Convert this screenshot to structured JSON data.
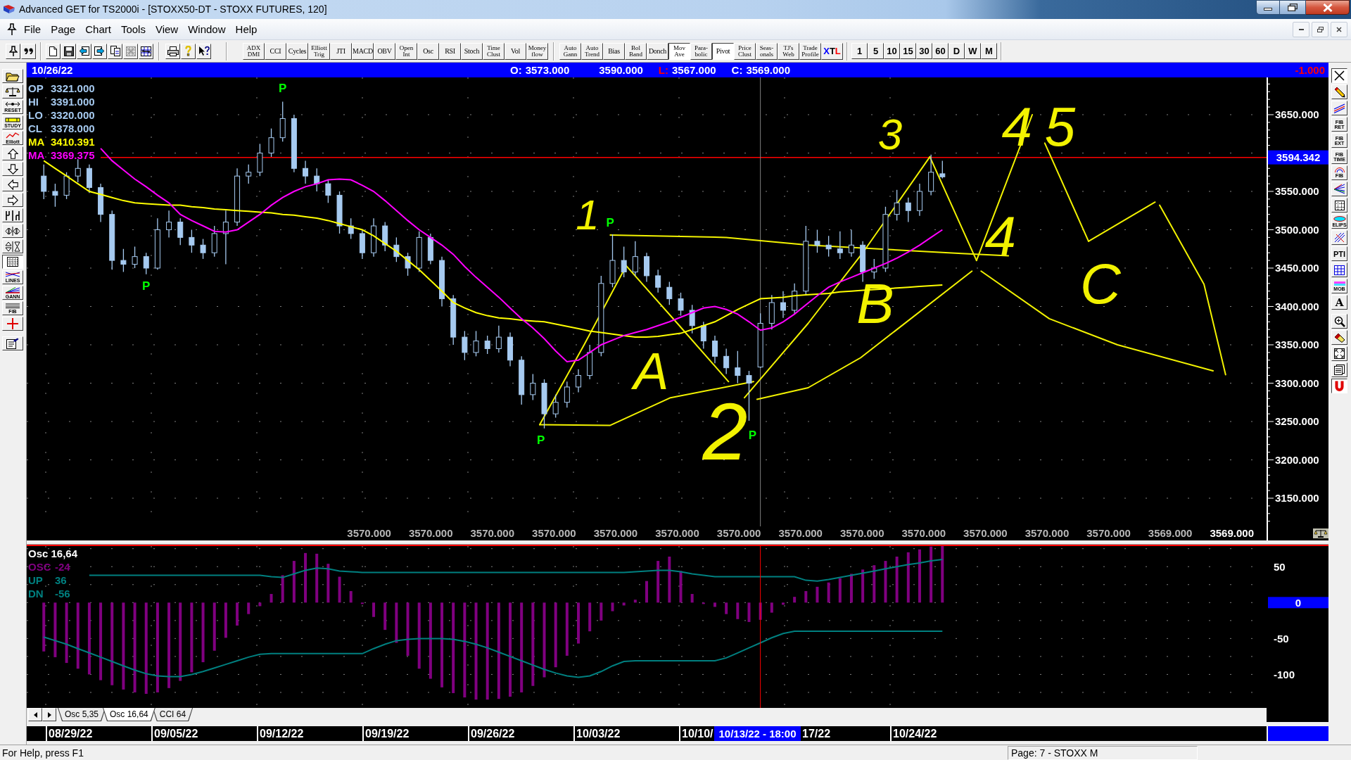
{
  "window": {
    "title": "Advanced GET for TS2000i - [STOXX50-DT - STOXX FUTURES, 120]"
  },
  "menu": [
    "File",
    "Page",
    "Chart",
    "Tools",
    "View",
    "Window",
    "Help"
  ],
  "toolbar": {
    "indicators": [
      {
        "label": "ADX\nDMI",
        "pressed": false
      },
      {
        "label": "CCI",
        "pressed": false
      },
      {
        "label": "Cycles",
        "pressed": false
      },
      {
        "label": "Elliott\nTrig",
        "pressed": false
      },
      {
        "label": "JTI",
        "pressed": false
      },
      {
        "label": "MACD",
        "pressed": false
      },
      {
        "label": "OBV",
        "pressed": false
      },
      {
        "label": "Open\nInt",
        "pressed": false
      },
      {
        "label": "Osc",
        "pressed": false
      },
      {
        "label": "RSI",
        "pressed": false
      },
      {
        "label": "Stoch",
        "pressed": false
      },
      {
        "label": "Time\nClust",
        "pressed": false
      },
      {
        "label": "Vol",
        "pressed": false
      },
      {
        "label": "Money\nflow",
        "pressed": false
      }
    ],
    "studies": [
      {
        "label": "Auto\nGann",
        "pressed": false
      },
      {
        "label": "Auto\nTrend",
        "pressed": false
      },
      {
        "label": "Bias",
        "pressed": false
      },
      {
        "label": "Bol\nBand",
        "pressed": false
      },
      {
        "label": "Donch",
        "pressed": false
      },
      {
        "label": "Mov\nAve",
        "pressed": true
      },
      {
        "label": "Para-\nbolic",
        "pressed": false
      },
      {
        "label": "Pivot",
        "pressed": true
      },
      {
        "label": "Price\nClust",
        "pressed": false
      },
      {
        "label": "Seas-\nonals",
        "pressed": false
      },
      {
        "label": "TJ's\nWeb",
        "pressed": false
      },
      {
        "label": "Trade\nProfile",
        "pressed": false
      },
      {
        "parts": [
          {
            "text": "X",
            "color": "#0000ff"
          },
          {
            "text": "T",
            "color": "#000000"
          },
          {
            "text": "L",
            "color": "#ff0000"
          }
        ],
        "pressed": false
      }
    ],
    "intervals": [
      {
        "label": "1",
        "pressed": false
      },
      {
        "label": "5",
        "pressed": false
      },
      {
        "label": "10",
        "pressed": false
      },
      {
        "label": "15",
        "pressed": false
      },
      {
        "label": "30",
        "pressed": false
      },
      {
        "label": "60",
        "pressed": false
      },
      {
        "label": "D",
        "pressed": false
      },
      {
        "label": "W",
        "pressed": false
      },
      {
        "label": "M",
        "pressed": false
      }
    ]
  },
  "left_toolbar": [
    {
      "kind": "open",
      "pressed": false
    },
    {
      "kind": "scales",
      "pressed": false
    },
    {
      "kind": "reset",
      "label": "RESET",
      "pressed": false
    },
    {
      "kind": "study",
      "label": "STUDY",
      "pressed": false
    },
    {
      "kind": "elliott",
      "label": "Elliott",
      "pressed": false
    },
    {
      "kind": "up",
      "pressed": false
    },
    {
      "kind": "down",
      "pressed": false
    },
    {
      "kind": "left",
      "pressed": false
    },
    {
      "kind": "right",
      "pressed": false
    },
    {
      "kind": "split",
      "pressed": false
    },
    {
      "kind": "h_arrows",
      "pressed": false
    },
    {
      "kind": "v_arrows",
      "pressed": false
    },
    {
      "kind": "grid",
      "pressed": true
    },
    {
      "kind": "lines",
      "label": "LINES",
      "pressed": false
    },
    {
      "kind": "gann",
      "label": "GANN",
      "pressed": false
    },
    {
      "kind": "fib",
      "label": "FIB",
      "pressed": false
    },
    {
      "kind": "cross",
      "pressed": false
    },
    {
      "kind": "clipboard",
      "pressed": false
    }
  ],
  "info_bar": {
    "date": "10/26/22",
    "quotes": [
      {
        "label": "O:",
        "color": "#ffffff",
        "value": "3573.000"
      },
      {
        "value": "3590.000"
      },
      {
        "label": "L:",
        "color": "#ff0000",
        "value": "3567.000"
      },
      {
        "label": "C:",
        "color": "#ffffff",
        "value": "3569.000"
      }
    ],
    "change": "-1.000"
  },
  "price_chart": {
    "legend": [
      {
        "label": "OP",
        "value": "3321.000",
        "color": "#a6caf0"
      },
      {
        "label": "HI",
        "value": "3391.000",
        "color": "#a6caf0"
      },
      {
        "label": "LO",
        "value": "3320.000",
        "color": "#a6caf0"
      },
      {
        "label": "CL",
        "value": "3378.000",
        "color": "#a6caf0"
      },
      {
        "label": "MA",
        "value": "3410.391",
        "color": "#ffff00"
      },
      {
        "label": "MA",
        "value": "3369.375",
        "color": "#ff00ff"
      }
    ],
    "chart_data": {
      "type": "candlestick",
      "ylim": [
        3113.3,
        3698.6
      ],
      "grid": true,
      "yticks": [
        {
          "value": 3150,
          "label": "3150.000"
        },
        {
          "value": 3200,
          "label": "3200.000"
        },
        {
          "value": 3250,
          "label": "3250.000"
        },
        {
          "value": 3300,
          "label": "3300.000"
        },
        {
          "value": 3350,
          "label": "3350.000"
        },
        {
          "value": 3400,
          "label": "3400.000"
        },
        {
          "value": 3450,
          "label": "3450.000"
        },
        {
          "value": 3500,
          "label": "3500.000"
        },
        {
          "value": 3550,
          "label": "3550.000"
        },
        {
          "value": 3650,
          "label": "3650.000"
        }
      ],
      "ohlc": [
        null,
        [
          3570,
          3585,
          3540,
          3550
        ],
        [
          3550,
          3560,
          3530,
          3545
        ],
        [
          3545,
          3575,
          3540,
          3570
        ],
        [
          3570,
          3592,
          3562,
          3580
        ],
        [
          3580,
          3585,
          3548,
          3555
        ],
        [
          3555,
          3560,
          3510,
          3520
        ],
        [
          3520,
          3525,
          3448,
          3460
        ],
        [
          3460,
          3475,
          3445,
          3455
        ],
        [
          3455,
          3478,
          3450,
          3465
        ],
        [
          3465,
          3470,
          3442,
          3450
        ],
        [
          3450,
          3515,
          3448,
          3500
        ],
        [
          3500,
          3525,
          3490,
          3510
        ],
        [
          3510,
          3515,
          3480,
          3490
        ],
        [
          3490,
          3500,
          3470,
          3480
        ],
        [
          3480,
          3488,
          3462,
          3470
        ],
        [
          3470,
          3505,
          3465,
          3495
        ],
        [
          3495,
          3525,
          3455,
          3510
        ],
        [
          3510,
          3580,
          3505,
          3570
        ],
        [
          3570,
          3585,
          3560,
          3575
        ],
        [
          3575,
          3612,
          3570,
          3600
        ],
        [
          3600,
          3632,
          3595,
          3620
        ],
        [
          3620,
          3667,
          3615,
          3645
        ],
        [
          3645,
          3650,
          3575,
          3580
        ],
        [
          3580,
          3590,
          3560,
          3570
        ],
        [
          3570,
          3580,
          3550,
          3560
        ],
        [
          3560,
          3565,
          3535,
          3545
        ],
        [
          3545,
          3550,
          3495,
          3505
        ],
        [
          3505,
          3515,
          3488,
          3495
        ],
        [
          3495,
          3500,
          3462,
          3470
        ],
        [
          3470,
          3515,
          3465,
          3505
        ],
        [
          3505,
          3510,
          3472,
          3480
        ],
        [
          3480,
          3490,
          3458,
          3465
        ],
        [
          3465,
          3470,
          3440,
          3450
        ],
        [
          3450,
          3498,
          3445,
          3490
        ],
        [
          3490,
          3495,
          3455,
          3460
        ],
        [
          3460,
          3465,
          3400,
          3410
        ],
        [
          3410,
          3415,
          3350,
          3360
        ],
        [
          3360,
          3368,
          3330,
          3340
        ],
        [
          3340,
          3368,
          3335,
          3355
        ],
        [
          3355,
          3362,
          3338,
          3345
        ],
        [
          3345,
          3375,
          3340,
          3360
        ],
        [
          3360,
          3366,
          3322,
          3330
        ],
        [
          3330,
          3335,
          3272,
          3285
        ],
        [
          3285,
          3312,
          3278,
          3300
        ],
        [
          3300,
          3305,
          3241,
          3260
        ],
        [
          3260,
          3285,
          3255,
          3275
        ],
        [
          3275,
          3302,
          3268,
          3295
        ],
        [
          3295,
          3318,
          3288,
          3310
        ],
        [
          3310,
          3350,
          3305,
          3340
        ],
        [
          3340,
          3440,
          3335,
          3430
        ],
        [
          3430,
          3494,
          3425,
          3460
        ],
        [
          3460,
          3478,
          3438,
          3445
        ],
        [
          3445,
          3485,
          3440,
          3465
        ],
        [
          3465,
          3470,
          3432,
          3440
        ],
        [
          3440,
          3448,
          3418,
          3425
        ],
        [
          3425,
          3432,
          3402,
          3410
        ],
        [
          3410,
          3418,
          3388,
          3395
        ],
        [
          3395,
          3402,
          3365,
          3375
        ],
        [
          3375,
          3380,
          3345,
          3355
        ],
        [
          3355,
          3362,
          3326,
          3335
        ],
        [
          3335,
          3345,
          3312,
          3320
        ],
        [
          3320,
          3342,
          3300,
          3310
        ],
        [
          3310,
          3316,
          3251,
          3300
        ],
        [
          3321,
          3391,
          3320,
          3378
        ],
        [
          3378,
          3415,
          3370,
          3405
        ],
        [
          3405,
          3420,
          3385,
          3395
        ],
        [
          3395,
          3430,
          3390,
          3420
        ],
        [
          3420,
          3505,
          3415,
          3485
        ],
        [
          3485,
          3500,
          3470,
          3480
        ],
        [
          3480,
          3492,
          3465,
          3475
        ],
        [
          3475,
          3498,
          3462,
          3470
        ],
        [
          3470,
          3500,
          3465,
          3480
        ],
        [
          3480,
          3485,
          3432,
          3445
        ],
        [
          3445,
          3462,
          3436,
          3450
        ],
        [
          3450,
          3530,
          3445,
          3520
        ],
        [
          3520,
          3552,
          3512,
          3535
        ],
        [
          3535,
          3542,
          3510,
          3525
        ],
        [
          3525,
          3560,
          3518,
          3550
        ],
        [
          3550,
          3598,
          3545,
          3575
        ],
        [
          3573,
          3590,
          3567,
          3569
        ],
        null,
        null,
        null,
        null,
        null,
        null,
        null,
        null,
        null,
        null,
        null,
        null,
        null,
        null,
        null,
        null,
        null,
        null,
        null,
        null,
        null,
        null,
        null,
        null,
        null,
        null,
        null,
        null
      ],
      "series": [
        {
          "type": "line",
          "color": "#ffff00",
          "values": [
            null,
            3590,
            3580,
            3570,
            3560,
            3550,
            3546,
            3542,
            3538,
            3535,
            3534,
            3533,
            3532,
            3532,
            3530,
            3529,
            3527,
            3526,
            3525,
            3524,
            3523,
            3522,
            3520,
            3519,
            3517,
            3515,
            3512,
            3508,
            3504,
            3500,
            3492,
            3482,
            3472,
            3460,
            3448,
            3434,
            3420,
            3405,
            3398,
            3392,
            3388,
            3385,
            3384,
            3382,
            3381,
            3380,
            3377,
            3374,
            3371,
            3368,
            3366,
            3364,
            3362,
            3360,
            3360,
            3361,
            3363,
            3365,
            3370,
            3375,
            3380,
            3388,
            3396,
            3403,
            3410,
            3411,
            3412,
            3414,
            3415,
            3416,
            3417,
            3419,
            3420,
            3421,
            3422,
            3423,
            3424,
            3425,
            3426,
            3427,
            3428,
            null,
            null,
            null,
            null,
            null,
            null,
            null,
            null,
            null,
            null,
            null,
            null,
            null,
            null,
            null,
            null,
            null,
            null,
            null,
            null,
            null,
            null,
            null,
            null,
            null,
            null,
            null,
            null
          ]
        },
        {
          "type": "line",
          "color": "#ff00ff",
          "values": [
            null,
            null,
            null,
            null,
            null,
            null,
            3606,
            3590,
            3578,
            3566,
            3556,
            3545,
            3535,
            3520,
            3512,
            3505,
            3498,
            3497,
            3500,
            3510,
            3520,
            3532,
            3542,
            3550,
            3556,
            3560,
            3565,
            3566,
            3565,
            3558,
            3550,
            3538,
            3525,
            3512,
            3500,
            3490,
            3480,
            3468,
            3452,
            3438,
            3425,
            3412,
            3398,
            3384,
            3372,
            3358,
            3342,
            3328,
            3330,
            3340,
            3350,
            3356,
            3362,
            3366,
            3370,
            3375,
            3380,
            3386,
            3392,
            3398,
            3400,
            3396,
            3390,
            3380,
            3369,
            3372,
            3380,
            3390,
            3402,
            3414,
            3425,
            3432,
            3438,
            3444,
            3450,
            3456,
            3463,
            3471,
            3480,
            3490,
            3500,
            null,
            null,
            null,
            null,
            null,
            null,
            null,
            null,
            null,
            null,
            null,
            null,
            null,
            null,
            null,
            null,
            null,
            null,
            null,
            null,
            null,
            null,
            null,
            null,
            null,
            null,
            null,
            null
          ]
        }
      ],
      "annotations": [
        "P",
        "P",
        "P",
        "P",
        "P"
      ],
      "ref_lines": [
        {
          "axis": "y",
          "value": 3594.342,
          "label": "3594.342"
        }
      ]
    },
    "handwritten_labels": [
      "1",
      "2",
      "3",
      "4",
      "45",
      "A",
      "B",
      "C"
    ],
    "footer": [
      {
        "text": "3570.000",
        "highlight": false
      },
      {
        "text": "3570.000",
        "highlight": false
      },
      {
        "text": "3570.000",
        "highlight": false
      },
      {
        "text": "3570.000",
        "highlight": false
      },
      {
        "text": "3570.000",
        "highlight": false
      },
      {
        "text": "3570.000",
        "highlight": false
      },
      {
        "text": "3570.000",
        "highlight": false
      },
      {
        "text": "3570.000",
        "highlight": false
      },
      {
        "text": "3570.000",
        "highlight": false
      },
      {
        "text": "3570.000",
        "highlight": false
      },
      {
        "text": "3570.000",
        "highlight": false
      },
      {
        "text": "3570.000",
        "highlight": false
      },
      {
        "text": "3570.000",
        "highlight": false
      },
      {
        "text": "3569.000",
        "highlight": false
      },
      {
        "text": "3569.000",
        "highlight": true
      }
    ]
  },
  "oscillator": {
    "legend": {
      "title": "Osc 16,64",
      "rows": [
        {
          "label": "OSC",
          "value": "-24",
          "color": "#800080"
        },
        {
          "label": "UP",
          "value": "36",
          "color": "#008080"
        },
        {
          "label": "DN",
          "value": "-56",
          "color": "#008080"
        }
      ]
    },
    "chart_data": {
      "type": "bar",
      "ylim": [
        -146.6,
        80.6
      ],
      "grid": true,
      "yticks": [
        {
          "value": 50,
          "label": "50"
        },
        {
          "value": -50,
          "label": "-50"
        },
        {
          "value": -100,
          "label": "-100"
        }
      ],
      "series": [
        {
          "color": "#800080",
          "values": [
            null,
            -68,
            -76,
            -84,
            -92,
            -100,
            -108,
            -115,
            -121,
            -125,
            -127,
            -125,
            -119,
            -109,
            -97,
            -83,
            -67,
            -49,
            -32,
            -16,
            -5,
            12,
            38,
            58,
            69,
            68,
            54,
            36,
            16,
            -2,
            -20,
            -38,
            -56,
            -74,
            -92,
            -106,
            -118,
            -126,
            -132,
            -135,
            -135,
            -134,
            -131,
            -125,
            -116,
            -104,
            -90,
            -74,
            -57,
            -40,
            -25,
            -12,
            -4,
            4,
            30,
            58,
            64,
            44,
            12,
            -2,
            -6,
            -16,
            -23,
            -27,
            -24,
            -14,
            -3,
            8,
            16,
            22,
            28,
            34,
            40,
            46,
            52,
            58,
            64,
            70,
            74,
            78,
            80,
            null,
            null,
            null,
            null,
            null,
            null,
            null,
            null,
            null,
            null,
            null,
            null,
            null,
            null,
            null,
            null,
            null,
            null,
            null,
            null,
            null,
            null,
            null,
            null,
            null,
            null,
            null,
            null
          ]
        },
        {
          "type": "line",
          "color": "#008080",
          "values": [
            null,
            null,
            null,
            null,
            null,
            38,
            38,
            38,
            38,
            38,
            38,
            38,
            38,
            38,
            38,
            38,
            38,
            38,
            38,
            38,
            38,
            36,
            35,
            40,
            45,
            48,
            47,
            44,
            43,
            42,
            42,
            42,
            42,
            42,
            42,
            42,
            42,
            42,
            42,
            42,
            42,
            42,
            42,
            42,
            42,
            42,
            42,
            42,
            42,
            42,
            42,
            42,
            42,
            43,
            44,
            45,
            45,
            43,
            40,
            38,
            36,
            36,
            36,
            36,
            36,
            36,
            36,
            36,
            31,
            30,
            32,
            35,
            38,
            41,
            44,
            47,
            50,
            53,
            55,
            58,
            60,
            null,
            null,
            null,
            null,
            null,
            null,
            null,
            null,
            null,
            null,
            null,
            null,
            null,
            null,
            null,
            null,
            null,
            null,
            null,
            null,
            null,
            null,
            null,
            null,
            null,
            null,
            null,
            null
          ]
        },
        {
          "type": "line",
          "color": "#008080",
          "values": [
            null,
            -48,
            -53,
            -58,
            -64,
            -70,
            -76,
            -82,
            -88,
            -94,
            -99,
            -102,
            -103,
            -103,
            -100,
            -96,
            -91,
            -86,
            -81,
            -76,
            -72,
            -71,
            -71,
            -71,
            -71,
            -71,
            -71,
            -71,
            -71,
            -71,
            -64,
            -58,
            -53,
            -51,
            -50,
            -50,
            -50,
            -51,
            -54,
            -58,
            -63,
            -69,
            -75,
            -81,
            -87,
            -93,
            -98,
            -102,
            -104,
            -102,
            -96,
            -88,
            -82,
            -81,
            -81,
            -81,
            -81,
            -81,
            -81,
            -81,
            -81,
            -77,
            -70,
            -63,
            -56,
            -49,
            -43,
            -40,
            -40,
            -40,
            -40,
            -40,
            -40,
            -40,
            -40,
            -40,
            -40,
            -40,
            -40,
            -40,
            -40,
            null,
            null,
            null,
            null,
            null,
            null,
            null,
            null,
            null,
            null,
            null,
            null,
            null,
            null,
            null,
            null,
            null,
            null,
            null,
            null,
            null,
            null,
            null,
            null,
            null,
            null,
            null,
            null
          ]
        }
      ],
      "ref_lines": [
        {
          "axis": "y",
          "value": 0,
          "label": "0"
        }
      ]
    }
  },
  "tabs": [
    {
      "label": "Osc 5,35",
      "selected": false
    },
    {
      "label": "Osc 16,64",
      "selected": true
    },
    {
      "label": "CCI 64",
      "selected": false
    }
  ],
  "date_axis": [
    {
      "kind": "date",
      "text": "08/29/22"
    },
    {
      "kind": "date",
      "text": "09/05/22"
    },
    {
      "kind": "date",
      "text": "09/12/22"
    },
    {
      "kind": "date",
      "text": "09/19/22"
    },
    {
      "kind": "date",
      "text": "09/26/22"
    },
    {
      "kind": "date",
      "text": "10/03/22"
    },
    {
      "kind": "date",
      "text": "10/10/"
    },
    {
      "kind": "cursor",
      "text": "10/13/22 - 18:00"
    },
    {
      "kind": "date",
      "text": "17/22"
    },
    {
      "kind": "date",
      "text": "10/24/22"
    }
  ],
  "right_toolbar": [
    {
      "kind": "cursor",
      "pressed": true
    },
    {
      "kind": "pencil",
      "pressed": false
    },
    {
      "kind": "lines",
      "pressed": false
    },
    {
      "kind": "fib_ret",
      "label": "FIB\nRET",
      "pressed": false
    },
    {
      "kind": "fib_ext",
      "label": "FIB\nEXT",
      "pressed": false
    },
    {
      "kind": "fib_time",
      "label": "FIB\nTIME",
      "pressed": false
    },
    {
      "kind": "fib_arc",
      "label": "FIB",
      "pressed": false
    },
    {
      "kind": "fan",
      "pressed": false
    },
    {
      "kind": "grid",
      "pressed": false
    },
    {
      "kind": "ellipse",
      "label": "ELIPS",
      "pressed": false
    },
    {
      "kind": "hatch",
      "pressed": false
    },
    {
      "kind": "pti",
      "label": "PTI",
      "pressed": false
    },
    {
      "kind": "grid_color",
      "pressed": false
    },
    {
      "kind": "mob",
      "label": "MOB",
      "pressed": false
    },
    {
      "kind": "text",
      "label": "A",
      "pressed": false
    },
    {
      "kind": "zoom",
      "pressed": false
    },
    {
      "kind": "eraser",
      "pressed": false
    },
    {
      "kind": "expand",
      "pressed": false
    },
    {
      "kind": "list",
      "pressed": false
    },
    {
      "kind": "magnet",
      "pressed": true
    }
  ],
  "status_bar": {
    "help": "For Help, press F1",
    "page": "Page: 7 - STOXX M"
  }
}
